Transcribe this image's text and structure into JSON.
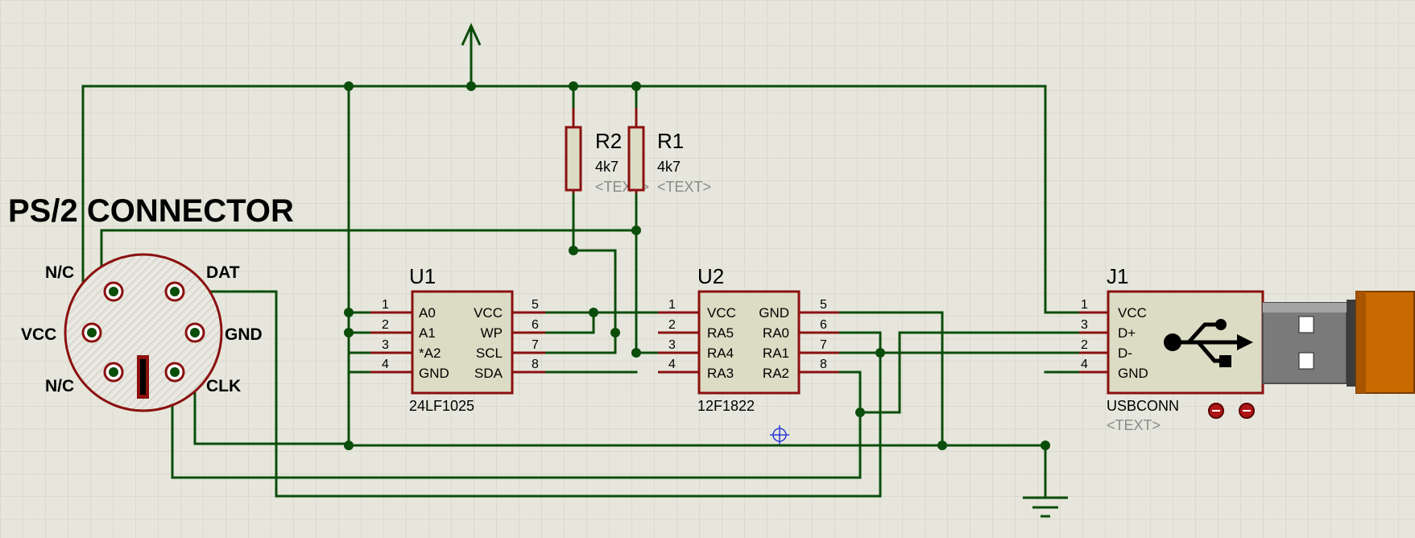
{
  "colors": {
    "wire": "#0b4d0b",
    "component_outline": "#8b1010",
    "component_fill": "#dcdcc4",
    "background": "#e6e6dc",
    "grid": "#cfcfc2",
    "usb_plug_orange": "#c86a00"
  },
  "ps2": {
    "title": "PS/2 CONNECTOR",
    "pins": {
      "nc_top": "N/C",
      "dat": "DAT",
      "vcc": "VCC",
      "gnd": "GND",
      "nc_bottom": "N/C",
      "clk": "CLK"
    }
  },
  "u1": {
    "ref": "U1",
    "part": "24LF1025",
    "left_pins": [
      {
        "num": "1",
        "name": "A0"
      },
      {
        "num": "2",
        "name": "A1"
      },
      {
        "num": "3",
        "name": "*A2"
      },
      {
        "num": "4",
        "name": "GND"
      }
    ],
    "right_pins": [
      {
        "num": "5",
        "name": "VCC"
      },
      {
        "num": "6",
        "name": "WP"
      },
      {
        "num": "7",
        "name": "SCL"
      },
      {
        "num": "8",
        "name": "SDA"
      }
    ]
  },
  "u2": {
    "ref": "U2",
    "part": "12F1822",
    "left_pins": [
      {
        "num": "1",
        "name": "VCC"
      },
      {
        "num": "2",
        "name": "RA5"
      },
      {
        "num": "3",
        "name": "RA4"
      },
      {
        "num": "4",
        "name": "RA3"
      }
    ],
    "right_pins": [
      {
        "num": "5",
        "name": "GND"
      },
      {
        "num": "6",
        "name": "RA0"
      },
      {
        "num": "7",
        "name": "RA1"
      },
      {
        "num": "8",
        "name": "RA2"
      }
    ]
  },
  "j1": {
    "ref": "J1",
    "part": "USBCONN",
    "text": "<TEXT>",
    "pins": [
      {
        "num": "1",
        "name": "VCC"
      },
      {
        "num": "3",
        "name": "D+"
      },
      {
        "num": "2",
        "name": "D-"
      },
      {
        "num": "4",
        "name": "GND"
      }
    ]
  },
  "r1": {
    "ref": "R1",
    "value": "4k7",
    "text": "<TEXT>"
  },
  "r2": {
    "ref": "R2",
    "value": "4k7",
    "text": "<TEXT>"
  },
  "icons": {
    "power": "power-arrow-icon",
    "ground": "ground-icon",
    "usb": "usb-symbol-icon",
    "cursor": "crosshair-cursor-icon"
  }
}
